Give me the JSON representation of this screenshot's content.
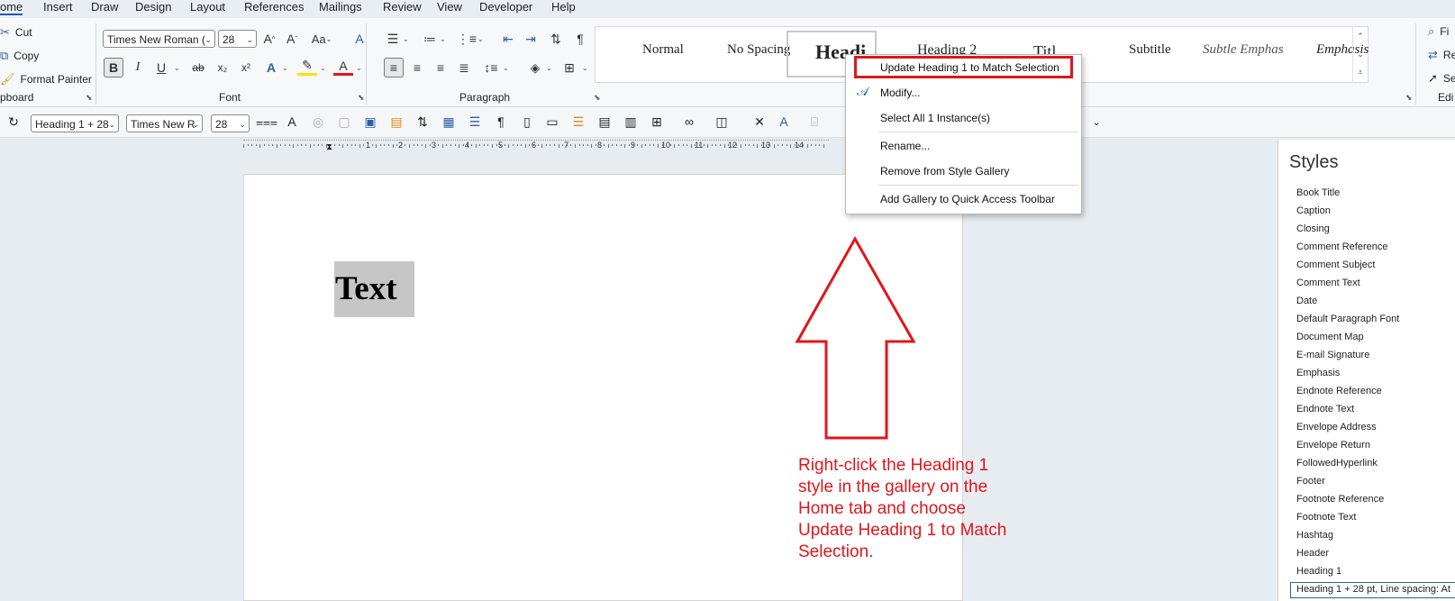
{
  "menubar": {
    "tabs": [
      "ome",
      "Insert",
      "Draw",
      "Design",
      "Layout",
      "References",
      "Mailings",
      "Review",
      "View",
      "Developer",
      "Help"
    ],
    "active": "ome"
  },
  "clipboard": {
    "cut": "Cut",
    "copy": "Copy",
    "format_painter": "Format Painter",
    "label": "pboard"
  },
  "font": {
    "name": "Times New Roman (",
    "size": "28",
    "label": "Font",
    "bold": "B",
    "italic": "I",
    "underline": "U",
    "strike": "ab",
    "subscript": "x₂",
    "superscript": "x²",
    "grow": "A^",
    "shrink": "A˅",
    "change_case": "Aa",
    "font_color": "A"
  },
  "paragraph": {
    "label": "Paragraph"
  },
  "gallery": {
    "items": [
      "Normal",
      "No Spacing",
      "Headi",
      "Heading 2",
      "Titl",
      "Subtitle",
      "Subtle Emphas",
      "Emphasis"
    ]
  },
  "qtoolbar": {
    "style_combo": "Heading 1 + 28",
    "font_combo": "Times New R",
    "size_combo": "28"
  },
  "ruler": {
    "numbers": [
      "1",
      "2",
      "3",
      "4",
      "5",
      "6",
      "7",
      "8",
      "9",
      "10",
      "11",
      "12",
      "13",
      "14"
    ]
  },
  "document": {
    "selected_text": "Text"
  },
  "context_menu": {
    "items": [
      "Update Heading 1 to Match Selection",
      "Modify...",
      "Select All 1 Instance(s)",
      "Rename...",
      "Remove from Style Gallery",
      "Add Gallery to Quick Access Toolbar"
    ]
  },
  "styles_pane": {
    "title": "Styles",
    "items": [
      "Book Title",
      "Caption",
      "Closing",
      "Comment Reference",
      "Comment Subject",
      "Comment Text",
      "Date",
      "Default Paragraph Font",
      "Document Map",
      "E-mail Signature",
      "Emphasis",
      "Endnote Reference",
      "Endnote Text",
      "Envelope Address",
      "Envelope Return",
      "FollowedHyperlink",
      "Footer",
      "Footnote Reference",
      "Footnote Text",
      "Hashtag",
      "Header",
      "Heading 1"
    ],
    "current": "Heading 1 + 28 pt, Line spacing: At"
  },
  "editing": {
    "find": "Fi",
    "replace": "Re",
    "select": "Se",
    "label": "Edi"
  },
  "annotation": {
    "text": "Right-click the Heading 1 style in the gallery on the Home tab and choose Update Heading 1 to Match Selection."
  },
  "colors": {
    "highlight_red": "#e0161c",
    "accent": "#2b5fa5",
    "selection_gray": "#c6c6c6"
  }
}
